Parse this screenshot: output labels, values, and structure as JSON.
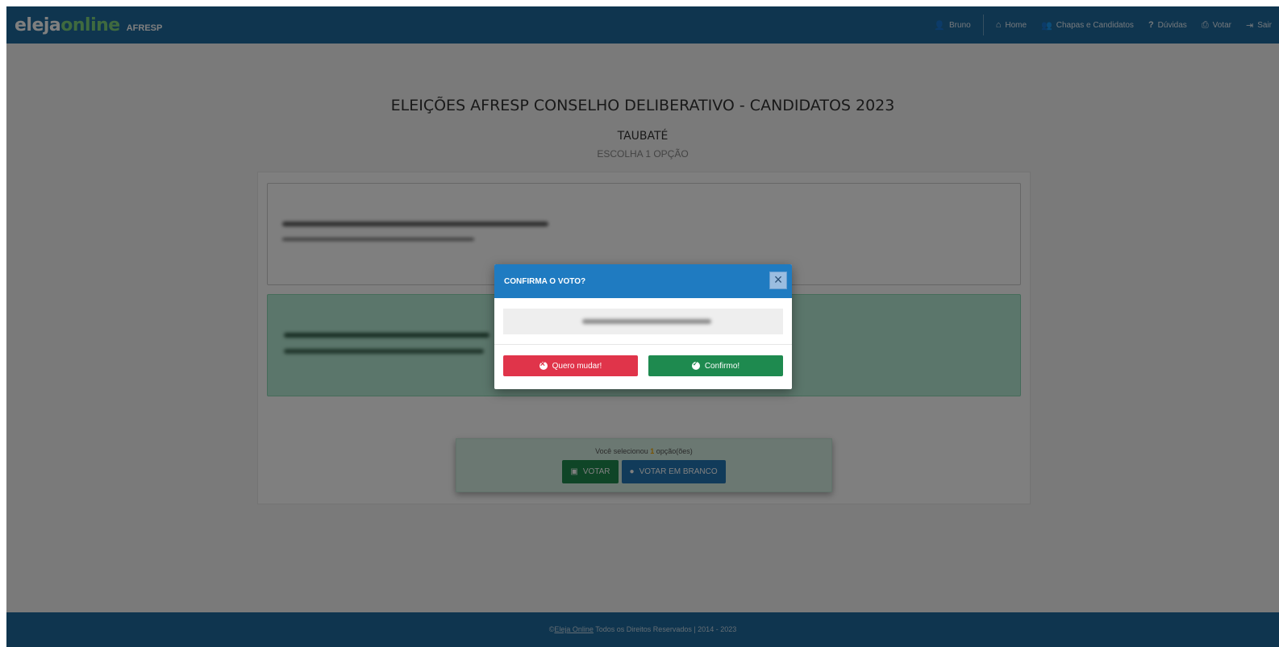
{
  "navbar": {
    "brand_main": "eleja",
    "brand_online": "online",
    "brand_org": "AFRESP",
    "user": "Bruno",
    "home": "Home",
    "chapas": "Chapas e Candidatos",
    "duvidas": "Dúvidas",
    "votar": "Votar",
    "sair": "Sair"
  },
  "page": {
    "title": "ELEIÇÕES AFRESP CONSELHO DELIBERATIVO - CANDIDATOS 2023",
    "city": "TAUBATÉ",
    "instruction": "ESCOLHA 1 OPÇÃO"
  },
  "vote_bar": {
    "status_prefix": "Você selecionou",
    "selected_count": "1",
    "status_suffix": "opção(ões)",
    "votar_label": "VOTAR",
    "branco_label": "VOTAR EM BRANCO"
  },
  "modal": {
    "title": "CONFIRMA O VOTO?",
    "close": "×",
    "cancel_label": "Quero mudar!",
    "confirm_label": "Confirmo!"
  },
  "footer": {
    "copyright": "©",
    "link": "Eleja Online",
    "text": "Todos os Direitos Reservados | 2014 - 2023"
  }
}
